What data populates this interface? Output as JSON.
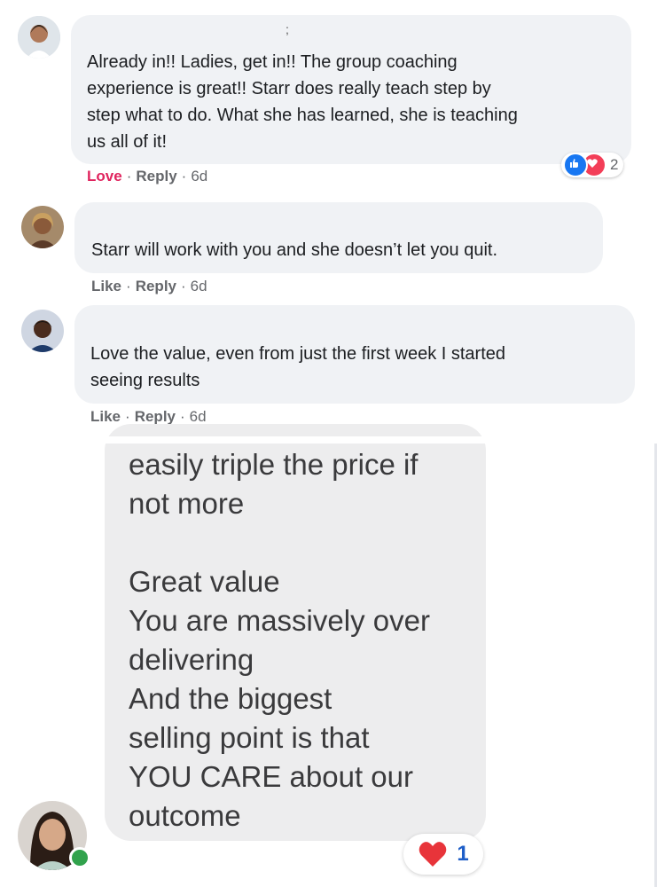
{
  "comments": [
    {
      "text_lines": [
        "Already in!! Ladies, get in!! The group coaching",
        "experience is great!! Starr does really teach step by",
        "step what to do. What she has learned, she is teaching",
        "us all of it!"
      ],
      "actions": {
        "reaction": "Love",
        "reply": "Reply",
        "time": "6d"
      },
      "reaction_count": "2",
      "marker": ";"
    },
    {
      "text_lines": [
        "Starr will work with you and she doesn’t let you quit."
      ],
      "actions": {
        "reaction": "Like",
        "reply": "Reply",
        "time": "6d"
      }
    },
    {
      "text_lines": [
        "Love the value, even from just the first week I started",
        "seeing results"
      ],
      "actions": {
        "reaction": "Like",
        "reply": "Reply",
        "time": "6d"
      }
    }
  ],
  "message": {
    "lines": [
      "easily triple the price if",
      "not more",
      "",
      "Great value",
      "You are massively over",
      "delivering",
      "And the biggest",
      "selling point is that",
      "YOU CARE about our",
      "outcome"
    ],
    "reaction_count": "1"
  },
  "colors": {
    "like_blue": "#1877f2",
    "love_red": "#f33e58",
    "online_green": "#31a24c"
  }
}
